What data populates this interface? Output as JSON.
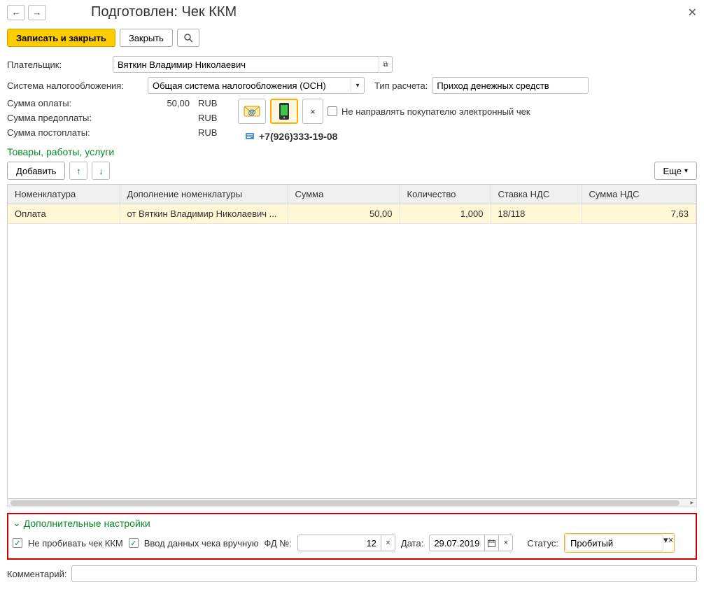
{
  "window": {
    "title": "Подготовлен: Чек ККМ"
  },
  "toolbar": {
    "save_close": "Записать и закрыть",
    "close": "Закрыть"
  },
  "payer": {
    "label": "Плательщик:",
    "value": "Вяткин Владимир Николаевич"
  },
  "tax_system": {
    "label": "Система налогообложения:",
    "value": "Общая система налогообложения (ОСН)"
  },
  "calc_type": {
    "label": "Тип расчета:",
    "value": "Приход денежных средств"
  },
  "amounts": {
    "payment_label": "Сумма оплаты:",
    "payment_value": "50,00",
    "prepayment_label": "Сумма предоплаты:",
    "prepayment_value": "",
    "postpayment_label": "Сумма постоплаты:",
    "postpayment_value": "",
    "currency": "RUB"
  },
  "no_echeck": {
    "label": "Не направлять покупателю электронный чек"
  },
  "phone": "+7(926)333-19-08",
  "section_goods": "Товары, работы, услуги",
  "goods_toolbar": {
    "add": "Добавить",
    "more": "Еще"
  },
  "grid": {
    "headers": {
      "nomenclature": "Номенклатура",
      "addition": "Дополнение номенклатуры",
      "sum": "Сумма",
      "qty": "Количество",
      "vat_rate": "Ставка НДС",
      "vat_sum": "Сумма НДС"
    },
    "rows": [
      {
        "nomenclature": "Оплата",
        "addition": "от Вяткин Владимир Николаевич ...",
        "sum": "50,00",
        "qty": "1,000",
        "vat_rate": "18/118",
        "vat_sum": "7,63"
      }
    ]
  },
  "extra": {
    "header": "Дополнительные настройки",
    "no_punch": "Не пробивать чек ККМ",
    "manual": "Ввод данных чека вручную",
    "fd_label": "ФД №:",
    "fd_value": "12",
    "date_label": "Дата:",
    "date_value": "29.07.2019",
    "status_label": "Статус:",
    "status_value": "Пробитый"
  },
  "comment": {
    "label": "Комментарий:",
    "value": ""
  }
}
